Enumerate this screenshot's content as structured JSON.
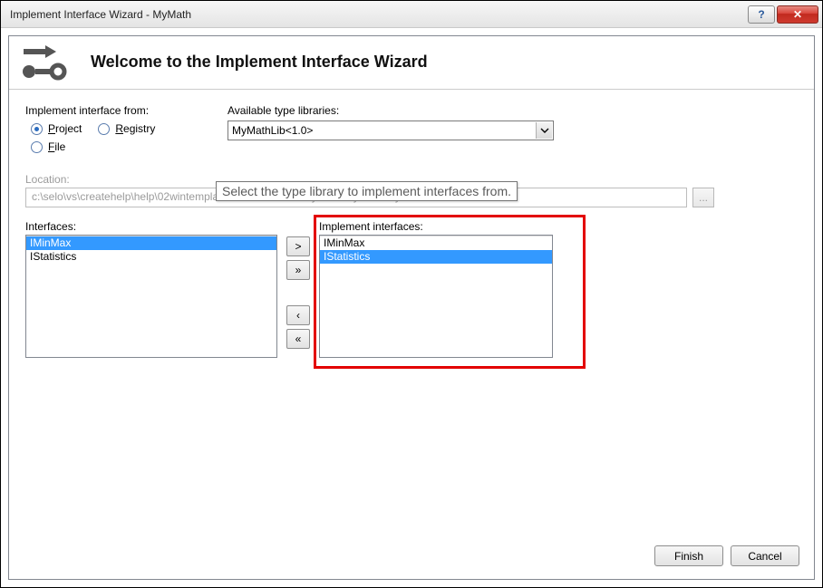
{
  "window": {
    "title": "Implement Interface Wizard - MyMath",
    "help_glyph": "?",
    "close_glyph": "✕"
  },
  "header": {
    "title": "Welcome to the Implement Interface Wizard"
  },
  "source": {
    "label": "Implement interface from:",
    "options": {
      "project": {
        "label": "Project",
        "underline": "P",
        "checked": true
      },
      "registry": {
        "label": "Registry",
        "underline": "R",
        "checked": false
      },
      "file": {
        "label": "File",
        "underline": "F",
        "checked": false
      }
    }
  },
  "typelib": {
    "label": "Available type libraries:",
    "selected": "MyMathLib<1.0>",
    "tooltip": "Select the type library to implement interfaces from."
  },
  "location": {
    "label": "Location:",
    "value": "c:\\selo\\vs\\createhelp\\help\\02wintempla\\35com\\09server\\mymath\\mymath\\mymath.idl",
    "browse_glyph": "..."
  },
  "interfaces": {
    "label": "Interfaces:",
    "items": [
      {
        "label": "IMinMax",
        "selected": true
      },
      {
        "label": "IStatistics",
        "selected": false
      }
    ]
  },
  "arrows": {
    "add": ">",
    "addAll": "»",
    "remove": "‹",
    "removeAll": "«"
  },
  "implement": {
    "label": "Implement interfaces:",
    "items": [
      {
        "label": "IMinMax",
        "selected": false
      },
      {
        "label": "IStatistics",
        "selected": true
      }
    ]
  },
  "buttons": {
    "finish": "Finish",
    "cancel": "Cancel"
  }
}
